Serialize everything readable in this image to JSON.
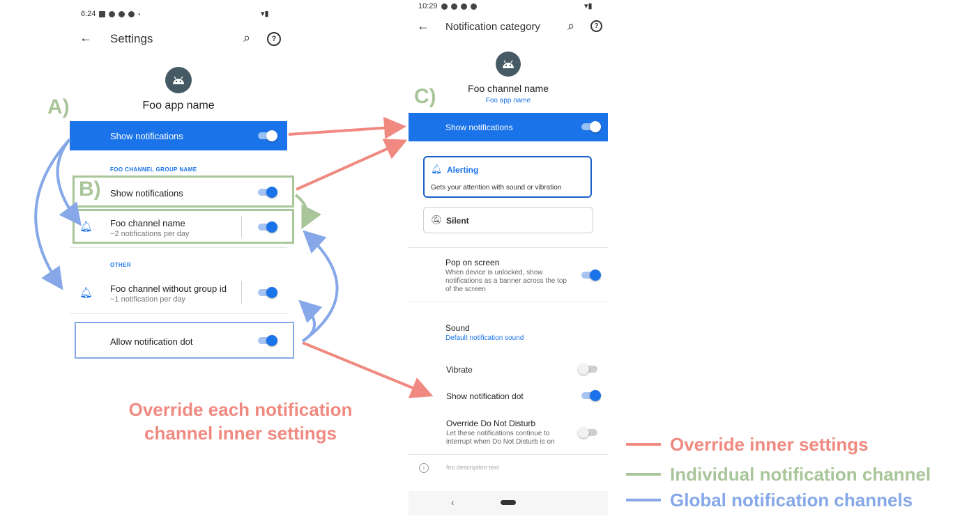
{
  "left": {
    "status": {
      "time": "6:24"
    },
    "appbar": {
      "title": "Settings"
    },
    "app_name": "Foo app name",
    "master_toggle": {
      "label": "Show notifications"
    },
    "group_header": "FOO CHANNEL GROUP NAME",
    "group_toggle": {
      "label": "Show notifications"
    },
    "channel": {
      "title": "Foo channel name",
      "subtitle": "~2 notifications per day"
    },
    "other_header": "OTHER",
    "channel2": {
      "title": "Foo channel without group id",
      "subtitle": "~1 notification per day"
    },
    "dot": {
      "label": "Allow notification dot"
    }
  },
  "right": {
    "status": {
      "time": "10:29"
    },
    "appbar": {
      "title": "Notification category"
    },
    "channel_name": "Foo channel name",
    "app_name": "Foo app name",
    "master_toggle": {
      "label": "Show notifications"
    },
    "alerting": {
      "title": "Alerting",
      "desc": "Gets your attention with sound or vibration"
    },
    "silent": {
      "title": "Silent"
    },
    "pop": {
      "title": "Pop on screen",
      "desc": "When device is unlocked, show notifications as a banner across the top of the screen"
    },
    "sound": {
      "title": "Sound",
      "desc": "Default notification sound"
    },
    "vibrate": {
      "title": "Vibrate"
    },
    "dot": {
      "title": "Show notification dot"
    },
    "dnd": {
      "title": "Override Do Not Disturb",
      "desc": "Let these notifications continue to interrupt when Do Not Disturb is on"
    },
    "footer": "foo description text"
  },
  "annotations": {
    "a": "A)",
    "b": "B)",
    "c": "C)",
    "override_each_line1": "Override each notification",
    "override_each_line2": "channel inner settings"
  },
  "legend": {
    "items": [
      {
        "label": "Override inner settings",
        "color": "#f08a80"
      },
      {
        "label": "Individual notification channel",
        "color": "#a9c59a"
      },
      {
        "label": "Global notification channels",
        "color": "#86a8e8"
      }
    ]
  },
  "colors": {
    "accent": "#1a73e8",
    "red": "#f08a80",
    "green": "#a9c59a",
    "blue": "#86a8e8"
  }
}
